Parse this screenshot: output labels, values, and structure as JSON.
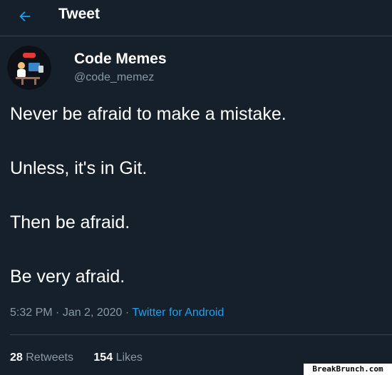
{
  "header": {
    "title": "Tweet",
    "back_icon": "arrow-left-icon",
    "accent": "#1da1f2"
  },
  "author": {
    "display_name": "Code Memes",
    "handle": "@code_memez",
    "avatar_icon": "avatar-coder-illustration"
  },
  "tweet": {
    "lines": [
      "Never be afraid to make a mistake.",
      "Unless, it's in Git.",
      "Then be afraid.",
      "Be very afraid."
    ],
    "time": "5:32 PM",
    "date": "Jan 2, 2020",
    "separator": " · ",
    "source": "Twitter for Android"
  },
  "stats": {
    "retweets_count": "28",
    "retweets_label": "Retweets",
    "likes_count": "154",
    "likes_label": "Likes"
  },
  "watermark": {
    "text": "BreakBrunch.com"
  },
  "colors": {
    "background": "#15202b",
    "divider": "#38444d",
    "muted": "#8899a6",
    "link": "#1da1f2"
  }
}
